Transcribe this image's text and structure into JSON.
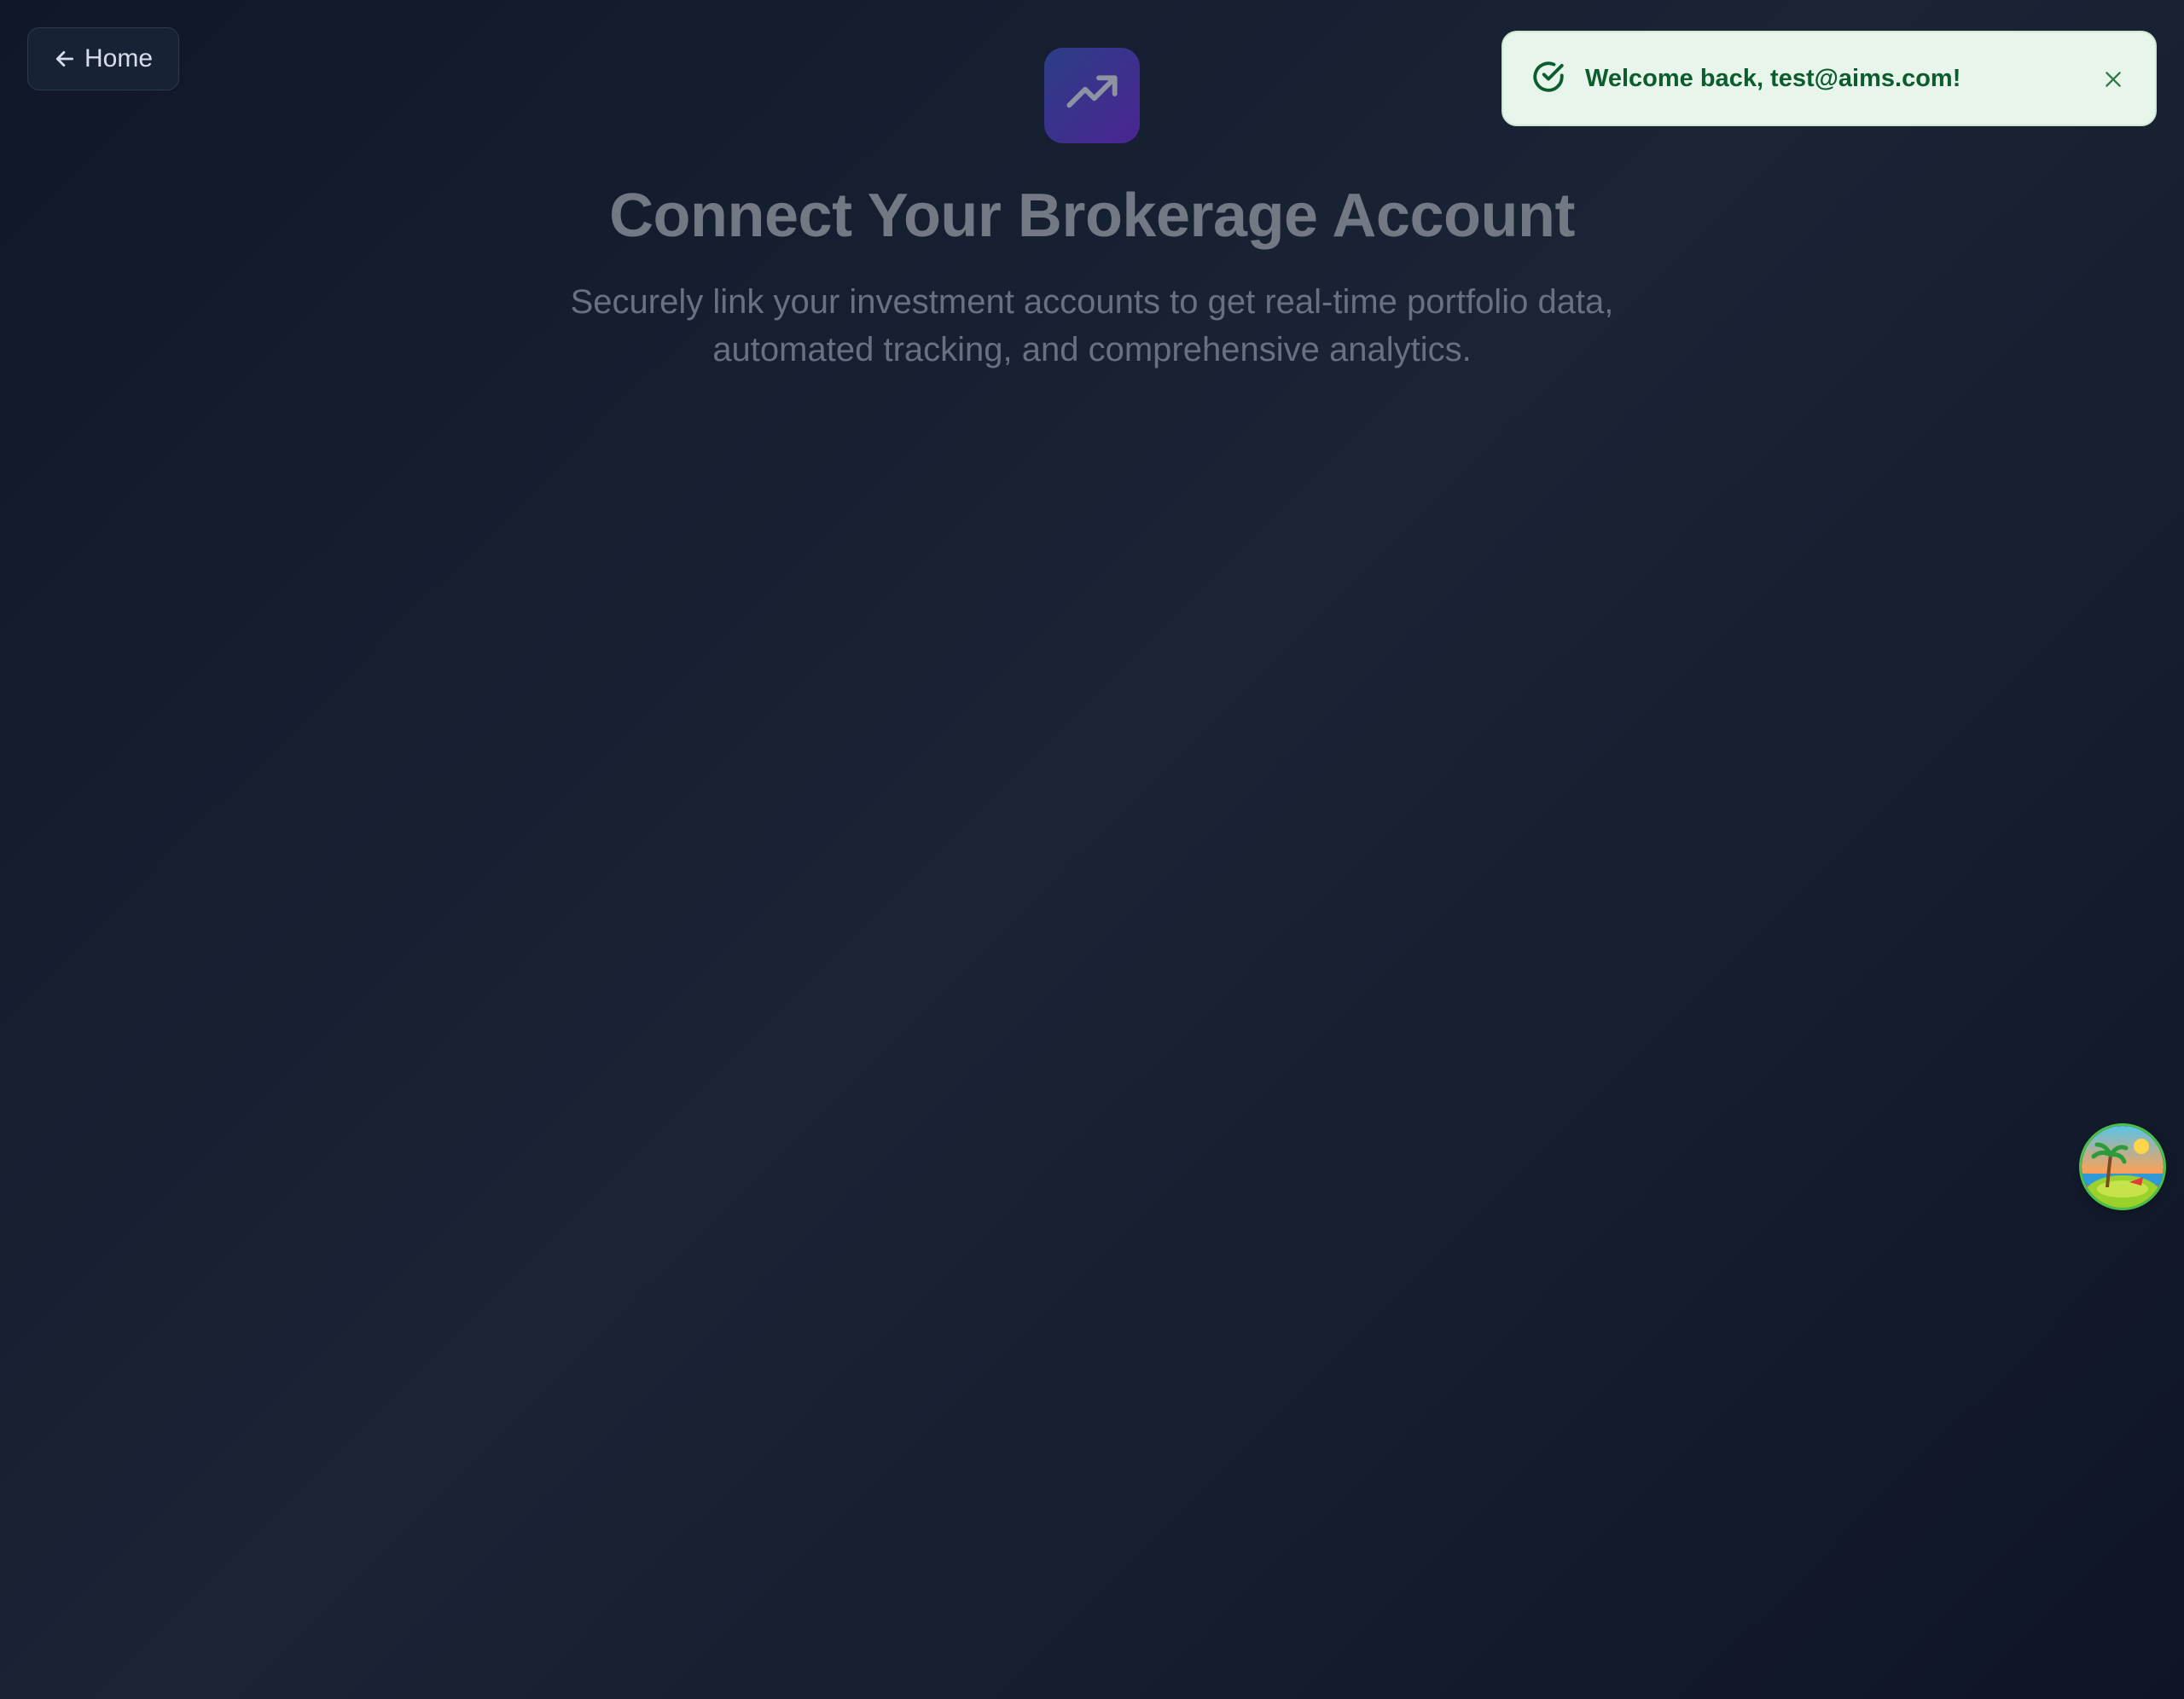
{
  "nav": {
    "home_label": "Home",
    "home_icon": "arrow-left-icon"
  },
  "logo": {
    "icon": "trending-up-icon"
  },
  "hero": {
    "title": "Connect Your Brokerage Account",
    "subtitle": "Securely link your investment accounts to get real-time portfolio data, automated tracking, and comprehensive analytics."
  },
  "toast": {
    "message": "Welcome back, test@aims.com!",
    "icon": "check-circle-icon",
    "close_icon": "close-icon"
  },
  "floating_avatar": {
    "icon": "island-avatar-icon"
  },
  "colors": {
    "background": "#141c2e",
    "toast_bg": "#e8f5ea",
    "toast_text": "#0b5c2e",
    "logo_gradient_start": "#2c3e86",
    "logo_gradient_end": "#4a2592"
  }
}
